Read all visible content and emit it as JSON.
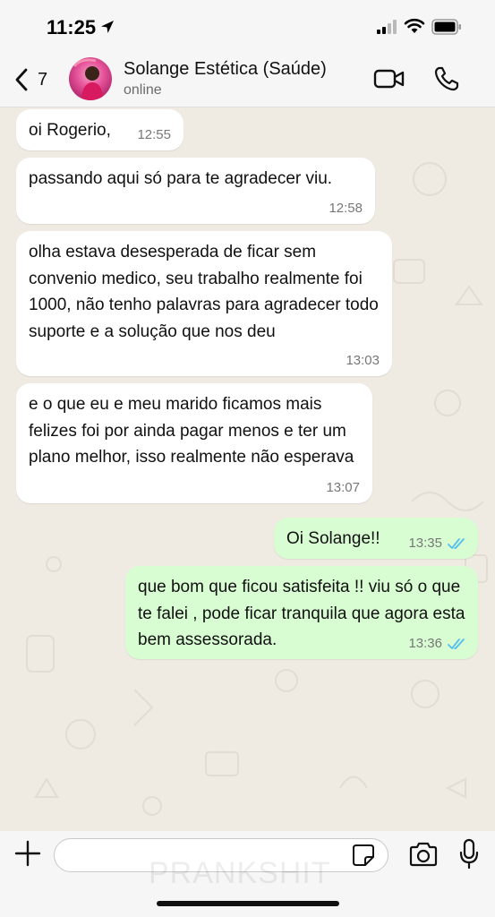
{
  "status_bar": {
    "time": "11:25",
    "icons": [
      "location-arrow-icon",
      "cellular-signal-icon",
      "wifi-icon",
      "battery-icon"
    ]
  },
  "header": {
    "back_count": "7",
    "contact_name": "Solange Estética (Saúde)",
    "contact_status": "online",
    "icons": [
      "back-chevron-icon",
      "video-call-icon",
      "voice-call-icon"
    ]
  },
  "watermark": "PRANKSHIT",
  "messages": [
    {
      "direction": "in",
      "text": "oi Rogerio,",
      "time": "12:55"
    },
    {
      "direction": "in",
      "text": "passando aqui só para te agradecer viu.",
      "time": "12:58"
    },
    {
      "direction": "in",
      "text": "olha estava desesperada de ficar sem convenio medico, seu trabalho realmente foi 1000, não tenho palavras para agradecer todo suporte e a solução que nos deu",
      "time": "13:03"
    },
    {
      "direction": "in",
      "text": "e o que eu e meu marido ficamos mais felizes foi por ainda pagar menos e ter um plano melhor, isso realmente não esperava",
      "time": "13:07"
    },
    {
      "direction": "out",
      "text": "Oi Solange!!",
      "time": "13:35",
      "read": true
    },
    {
      "direction": "out",
      "text": "que bom que ficou satisfeita !! viu só o que te falei , pode ficar tranquila que agora esta bem assessorada.",
      "time": "13:36",
      "read": true
    }
  ],
  "input_bar": {
    "placeholder": "",
    "icons": [
      "plus-icon",
      "sticker-icon",
      "camera-icon",
      "microphone-icon"
    ]
  },
  "colors": {
    "incoming_bubble": "#ffffff",
    "outgoing_bubble": "#d9fdd3",
    "chat_background": "#efeae2",
    "read_ticks": "#53bdeb"
  }
}
